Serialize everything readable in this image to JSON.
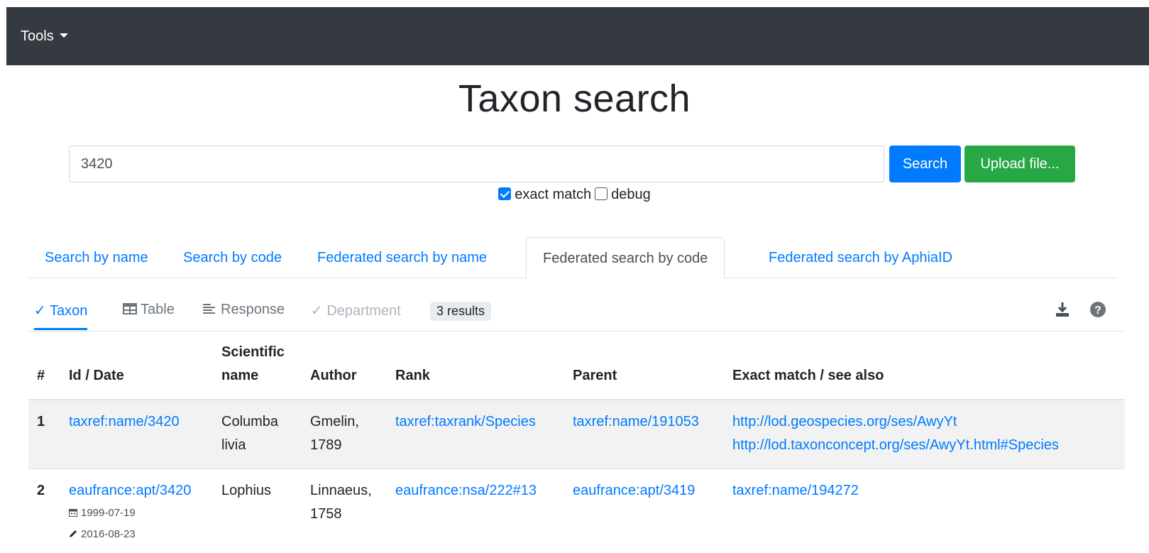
{
  "navbar": {
    "tools_label": "Tools"
  },
  "page_title": "Taxon search",
  "search": {
    "value": "3420",
    "search_label": "Search",
    "upload_label": "Upload file..."
  },
  "options": {
    "exact_match_label": "exact match",
    "exact_match_checked": true,
    "debug_label": "debug",
    "debug_checked": false
  },
  "tabs": [
    {
      "label": "Search by name",
      "active": false
    },
    {
      "label": "Search by code",
      "active": false
    },
    {
      "label": "Federated search by name",
      "active": false
    },
    {
      "label": "Federated search by code",
      "active": true
    },
    {
      "label": "Federated search by AphiaID",
      "active": false
    }
  ],
  "subnav": {
    "taxon_label": "✓ Taxon",
    "table_label": "Table",
    "response_label": "Response",
    "department_label": "✓ Department",
    "results_badge": "3 results",
    "icons": [
      "download-icon",
      "help-icon"
    ]
  },
  "table": {
    "headers": {
      "num": "#",
      "id_date": "Id / Date",
      "scientific_name": "Scientific name",
      "author": "Author",
      "rank": "Rank",
      "parent": "Parent",
      "exact_match": "Exact match / see also"
    },
    "rows": [
      {
        "num": "1",
        "id": "taxref:name/3420",
        "created": "",
        "modified": "",
        "scientific_name": "Columba livia",
        "author": "Gmelin, 1789",
        "rank": "taxref:taxrank/Species",
        "parent": "taxref:name/191053",
        "matches": [
          "http://lod.geospecies.org/ses/AwyYt",
          "http://lod.taxonconcept.org/ses/AwyYt.html#Species"
        ]
      },
      {
        "num": "2",
        "id": "eaufrance:apt/3420",
        "created": "1999-07-19",
        "modified": "2016-08-23",
        "scientific_name": "Lophius",
        "author": "Linnaeus, 1758",
        "rank": "eaufrance:nsa/222#13",
        "parent": "eaufrance:apt/3419",
        "matches": [
          "taxref:name/194272"
        ]
      }
    ]
  },
  "colors": {
    "navbar": "#343a40",
    "link": "#007bff",
    "search_button": "#007bff",
    "upload_button": "#28a745"
  }
}
